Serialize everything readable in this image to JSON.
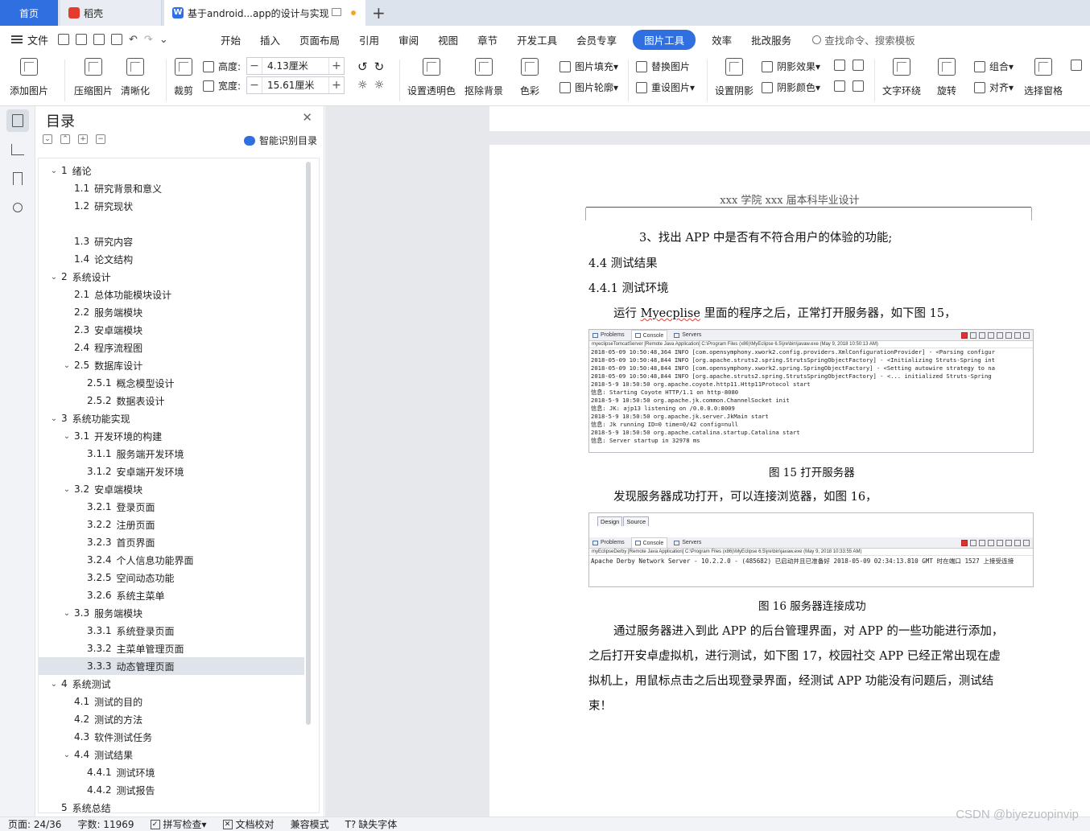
{
  "tabs": {
    "home": "首页",
    "docer": "稻壳",
    "doc": "基于android...app的设计与实现",
    "add": "+"
  },
  "menu": {
    "file": "文件",
    "items": [
      "开始",
      "插入",
      "页面布局",
      "引用",
      "审阅",
      "视图",
      "章节",
      "开发工具",
      "会员专享"
    ],
    "active": "图片工具",
    "after": [
      "效率",
      "批改服务"
    ],
    "search": "查找命令、搜索模板"
  },
  "ribbon": {
    "add_picture": "添加图片",
    "compress": "压缩图片",
    "clarify": "清晰化",
    "crop": "裁剪",
    "height_label": "高度:",
    "height_value": "4.13厘米",
    "width_label": "宽度:",
    "width_value": "15.61厘米",
    "transparent": "设置透明色",
    "remove_bg": "抠除背景",
    "color": "色彩",
    "fill": "图片填充",
    "outline": "图片轮廓",
    "replace": "替换图片",
    "reset": "重设图片",
    "shadow": "设置阴影",
    "shadow_effect": "阴影效果",
    "shadow_color": "阴影颜色",
    "wrap": "文字环绕",
    "rotate": "旋转",
    "group": "组合",
    "align": "对齐",
    "select_pane": "选择窗格"
  },
  "toc": {
    "title": "目录",
    "smart": "智能识别目录",
    "items": [
      {
        "num": "1",
        "text": "绪论",
        "level": 1,
        "chev": "⌄"
      },
      {
        "num": "1.1",
        "text": "研究背景和意义",
        "level": 2
      },
      {
        "num": "1.2",
        "text": "研究现状",
        "level": 2
      },
      {
        "num": "1.3",
        "text": "研究内容",
        "level": 2
      },
      {
        "num": "1.4",
        "text": "论文结构",
        "level": 2
      },
      {
        "num": "2",
        "text": "系统设计",
        "level": 1,
        "chev": "⌄"
      },
      {
        "num": "2.1",
        "text": "总体功能模块设计",
        "level": 2
      },
      {
        "num": "2.2",
        "text": "服务端模块",
        "level": 2
      },
      {
        "num": "2.3",
        "text": "安卓端模块",
        "level": 2
      },
      {
        "num": "2.4",
        "text": "程序流程图",
        "level": 2
      },
      {
        "num": "2.5",
        "text": "数据库设计",
        "level": 2,
        "chev": "⌄"
      },
      {
        "num": "2.5.1",
        "text": "概念模型设计",
        "level": 3
      },
      {
        "num": "2.5.2",
        "text": "数据表设计",
        "level": 3
      },
      {
        "num": "3",
        "text": "系统功能实现",
        "level": 1,
        "chev": "⌄"
      },
      {
        "num": "3.1",
        "text": "开发环境的构建",
        "level": 2,
        "chev": "⌄"
      },
      {
        "num": "3.1.1",
        "text": "服务端开发环境",
        "level": 3
      },
      {
        "num": "3.1.2",
        "text": "安卓端开发环境",
        "level": 3
      },
      {
        "num": "3.2",
        "text": "安卓端模块",
        "level": 2,
        "chev": "⌄"
      },
      {
        "num": "3.2.1",
        "text": "登录页面",
        "level": 3
      },
      {
        "num": "3.2.2",
        "text": "注册页面",
        "level": 3
      },
      {
        "num": "3.2.3",
        "text": "首页界面",
        "level": 3
      },
      {
        "num": "3.2.4",
        "text": "个人信息功能界面",
        "level": 3
      },
      {
        "num": "3.2.5",
        "text": "空间动态功能",
        "level": 3
      },
      {
        "num": "3.2.6",
        "text": "系统主菜单",
        "level": 3
      },
      {
        "num": "3.3",
        "text": "服务端模块",
        "level": 2,
        "chev": "⌄"
      },
      {
        "num": "3.3.1",
        "text": "系统登录页面",
        "level": 3
      },
      {
        "num": "3.3.2",
        "text": "主菜单管理页面",
        "level": 3
      },
      {
        "num": "3.3.3",
        "text": "动态管理页面",
        "level": 3,
        "selected": true
      },
      {
        "num": "4",
        "text": "系统测试",
        "level": 1,
        "chev": "⌄"
      },
      {
        "num": "4.1",
        "text": "测试的目的",
        "level": 2
      },
      {
        "num": "4.2",
        "text": "测试的方法",
        "level": 2
      },
      {
        "num": "4.3",
        "text": "软件测试任务",
        "level": 2
      },
      {
        "num": "4.4",
        "text": "测试结果",
        "level": 2,
        "chev": "⌄"
      },
      {
        "num": "4.4.1",
        "text": "测试环境",
        "level": 3
      },
      {
        "num": "4.4.2",
        "text": "测试报告",
        "level": 3
      },
      {
        "num": "5",
        "text": "系统总结",
        "level": 1
      }
    ]
  },
  "page": {
    "header": "xxx 学院 xxx 届本科毕业设计",
    "line1": "3、找出 APP 中是否有不符合用户的体验的功能;",
    "h1": "4.4 测试结果",
    "h2": "4.4.1 测试环境",
    "para1_a": "运行 ",
    "para1_b": "Myecplise",
    "para1_c": " 里面的程序之后，正常打开服务器，如下图 15，",
    "cap15": "图 15 打开服务器",
    "para2": "发现服务器成功打开，可以连接浏览器，如图 16，",
    "cap16": "图 16 服务器连接成功",
    "para3_1": "通过服务器进入到此 APP 的后台管理界面，对 APP 的一些功能进行添加，",
    "para3_2": "之后打开安卓虚拟机，进行测试，如下图 17，校园社交 APP 已经正常出现在虚",
    "para3_3": "拟机上，用鼠标点击之后出现登录界面，经测试 APP 功能没有问题后，测试结",
    "para3_4": "束！"
  },
  "console15": {
    "tabs": [
      "Problems",
      "Console",
      "Servers"
    ],
    "path": "myeclipseTomcatServer [Remote Java Application] C:\\Program Files (x86)\\MyEclipse 6.5\\jre\\bin\\javaw.exe (May 9, 2018 10:50:13 AM)",
    "lines": [
      "2018-05-09 10:50:48,364 INFO [com.opensymphony.xwork2.config.providers.XmlConfigurationProvider] - <Parsing configur",
      "2018-05-09 10:50:48,844 INFO [org.apache.struts2.spring.StrutsSpringObjectFactory] - <Initializing Struts-Spring int",
      "2018-05-09 10:50:48,844 INFO [com.opensymphony.xwork2.spring.SpringObjectFactory] - <Setting autowire strategy to na",
      "2018-05-09 10:50:48,844 INFO [org.apache.struts2.spring.StrutsSpringObjectFactory] - <... initialized Struts-Spring",
      "2018-5-9 10:50:50 org.apache.coyote.http11.Http11Protocol start",
      "信息: Starting Coyote HTTP/1.1 on http-8080",
      "2018-5-9 10:50:50 org.apache.jk.common.ChannelSocket init",
      "信息: JK: ajp13 listening on /0.0.0.0:8009",
      "2018-5-9 10:50:50 org.apache.jk.server.JkMain start",
      "信息: Jk running ID=0 time=0/42  config=null",
      "2018-5-9 10:50:50 org.apache.catalina.startup.Catalina start",
      "信息: Server startup in 32978 ms"
    ]
  },
  "console16": {
    "design_tabs": [
      "Design",
      "Source"
    ],
    "tabs": [
      "Problems",
      "Console",
      "Servers"
    ],
    "path": "myEclipseDerby [Remote Java Application] C:\\Program Files (x86)\\MyEclipse 6.5\\jre\\bin\\javaw.exe (May 9, 2018 10:33:55 AM)",
    "line": "Apache Derby Network Server - 10.2.2.0 - (485682) 已启动并且已准备好 2018-05-09 02:34:13.810 GMT 时在端口 1527 上接受连接"
  },
  "status": {
    "page": "页面: 24/36",
    "words": "字数: 11969",
    "spell": "拼写检查",
    "proof": "文档校对",
    "compat": "兼容模式",
    "missing_font": "缺失字体"
  },
  "watermark": "CSDN @biyezuopinvip"
}
